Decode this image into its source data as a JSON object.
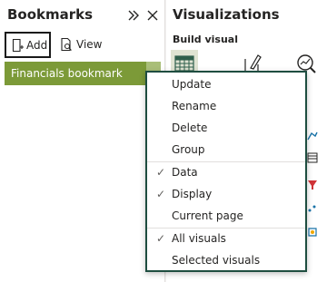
{
  "bookmarks_pane": {
    "title": "Bookmarks",
    "add_label": "Add",
    "view_label": "View",
    "items": [
      {
        "label": "Financials bookmark"
      }
    ]
  },
  "visualizations_pane": {
    "title": "Visualizations",
    "build_visual_label": "Build visual"
  },
  "context_menu": {
    "items": [
      {
        "label": "Update",
        "checked": false
      },
      {
        "label": "Rename",
        "checked": false
      },
      {
        "label": "Delete",
        "checked": false
      },
      {
        "label": "Group",
        "checked": false
      },
      {
        "label": "Data",
        "checked": true
      },
      {
        "label": "Display",
        "checked": true
      },
      {
        "label": "Current page",
        "checked": false
      },
      {
        "label": "All visuals",
        "checked": true
      },
      {
        "label": "Selected visuals",
        "checked": false
      }
    ],
    "check_glyph": "✓"
  },
  "colors": {
    "selected_bookmark": "#7c9a38",
    "menu_border": "#1e4d40"
  }
}
